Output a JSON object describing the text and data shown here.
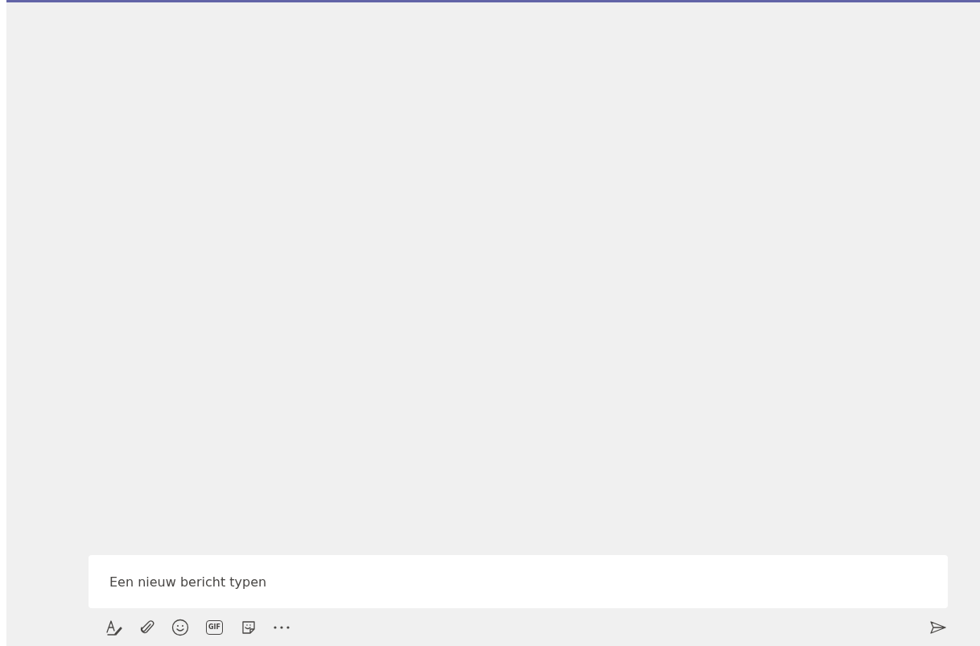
{
  "compose": {
    "placeholder": "Een nieuw bericht typen"
  },
  "toolbar": [
    {
      "kind": "format"
    },
    {
      "kind": "attach"
    },
    {
      "kind": "emoji"
    },
    {
      "kind": "gif",
      "label": "GIF"
    },
    {
      "kind": "sticker"
    },
    {
      "kind": "more"
    }
  ],
  "send": {
    "kind": "send"
  }
}
